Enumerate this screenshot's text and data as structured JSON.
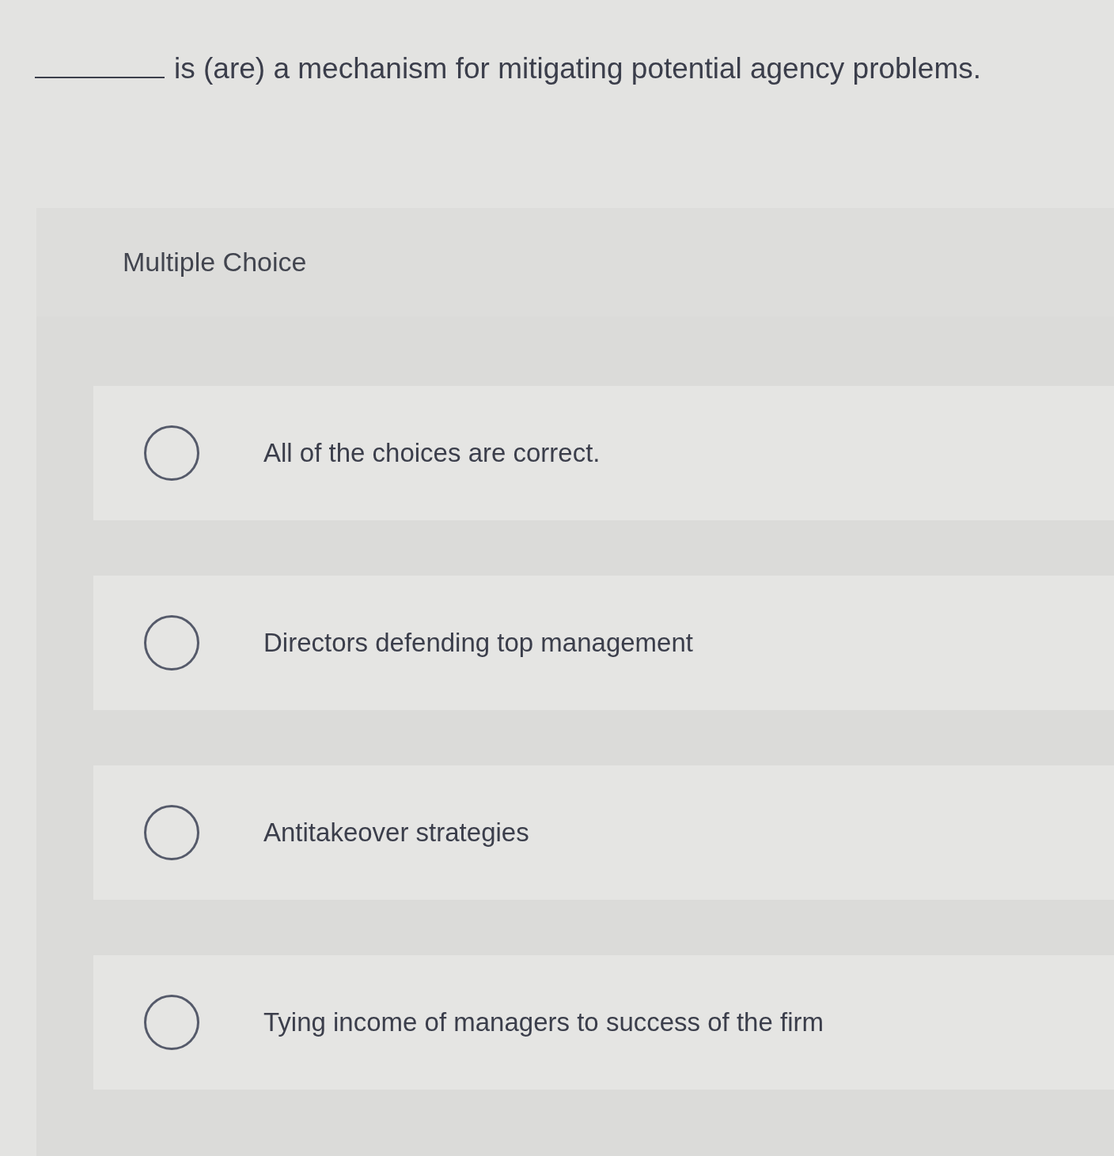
{
  "question": {
    "text": "is (are) a mechanism for mitigating potential agency problems."
  },
  "panel": {
    "type_label": "Multiple Choice"
  },
  "choices": [
    {
      "label": "All of the choices are correct.",
      "selected": false
    },
    {
      "label": "Directors defending top management",
      "selected": false
    },
    {
      "label": "Antitakeover strategies",
      "selected": false
    },
    {
      "label": "Tying income of managers to success of the firm",
      "selected": false
    }
  ]
}
